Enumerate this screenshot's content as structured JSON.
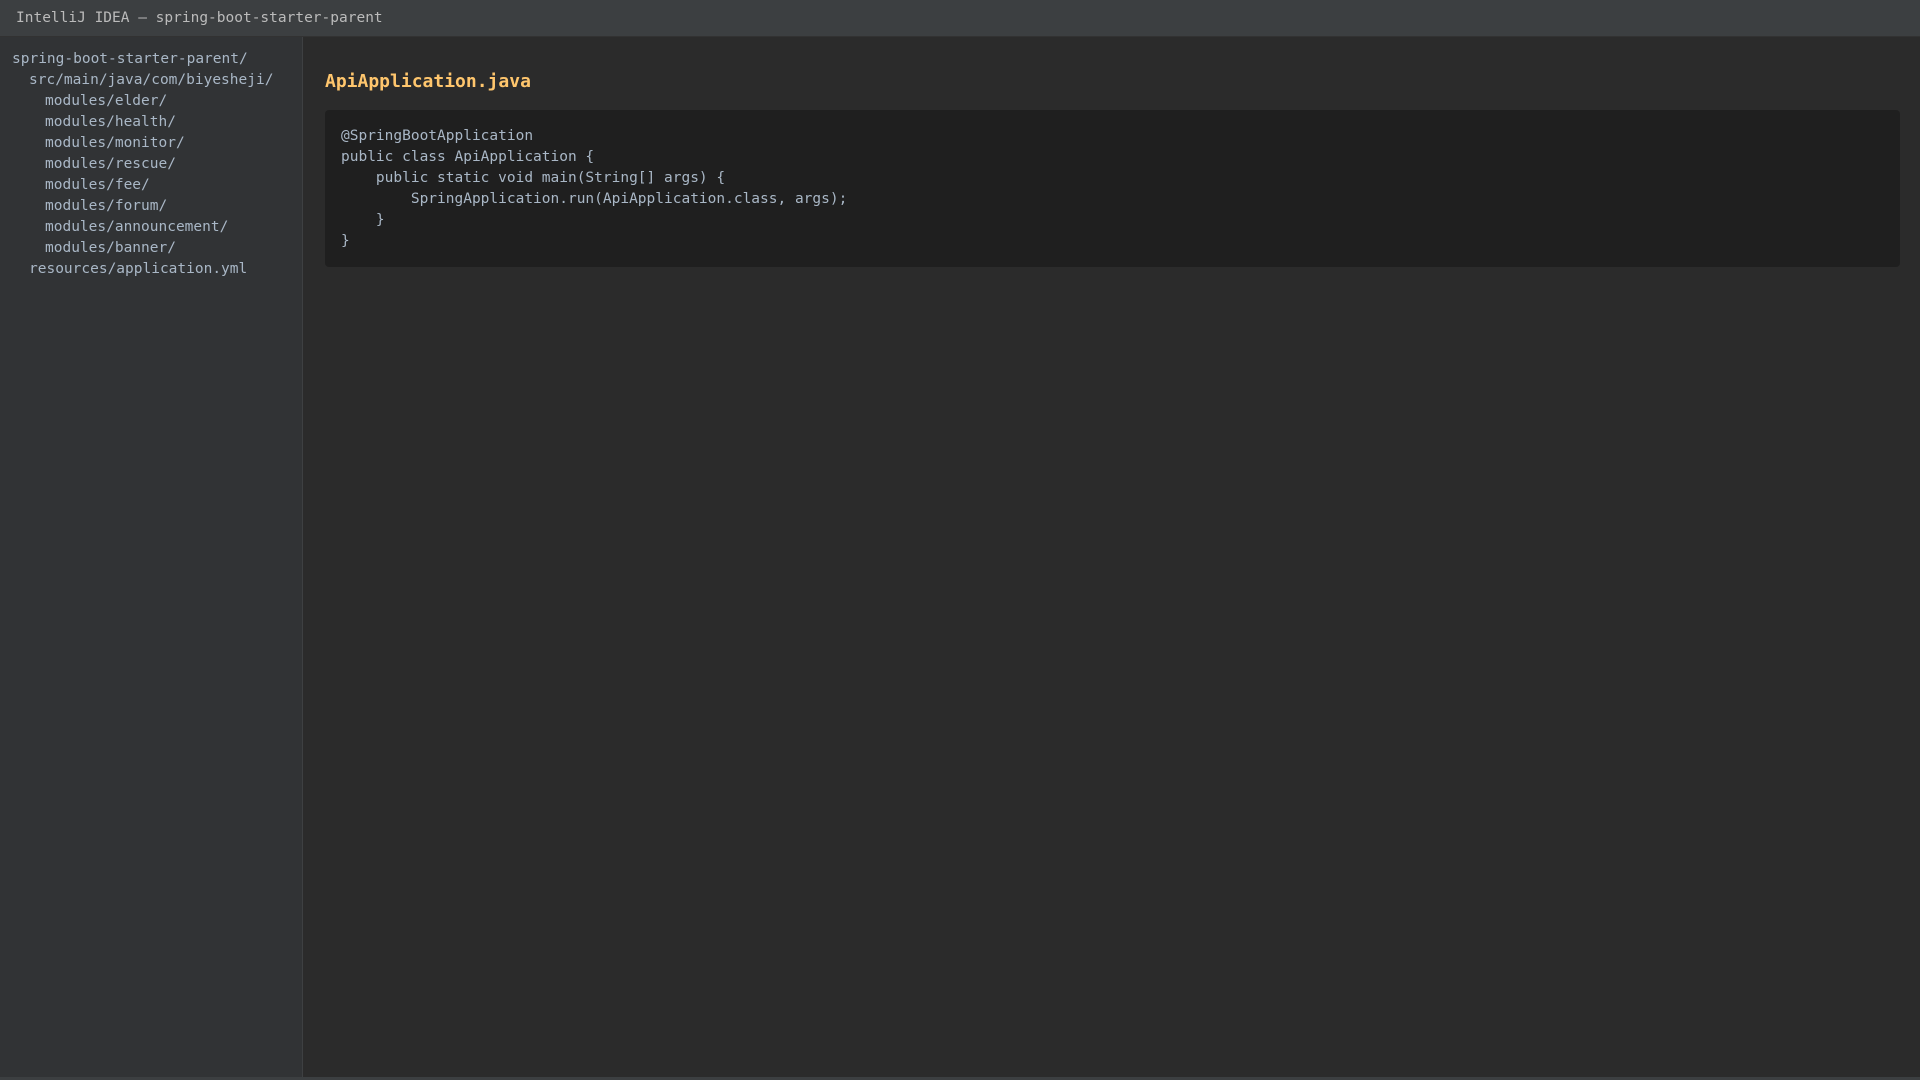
{
  "window": {
    "title": "IntelliJ IDEA — spring-boot-starter-parent"
  },
  "project_tree": {
    "items": [
      {
        "label": "spring-boot-starter-parent/",
        "depth": 0
      },
      {
        "label": "src/main/java/com/biyesheji/",
        "depth": 1
      },
      {
        "label": "modules/elder/",
        "depth": 2
      },
      {
        "label": "modules/health/",
        "depth": 2
      },
      {
        "label": "modules/monitor/",
        "depth": 2
      },
      {
        "label": "modules/rescue/",
        "depth": 2
      },
      {
        "label": "modules/fee/",
        "depth": 2
      },
      {
        "label": "modules/forum/",
        "depth": 2
      },
      {
        "label": "modules/announcement/",
        "depth": 2
      },
      {
        "label": "modules/banner/",
        "depth": 2
      },
      {
        "label": "resources/application.yml",
        "depth": 1
      }
    ]
  },
  "editor": {
    "file_name": "ApiApplication.java",
    "code_lines": [
      "@SpringBootApplication",
      "public class ApiApplication {",
      "    public static void main(String[] args) {",
      "        SpringApplication.run(ApiApplication.class, args);",
      "    }",
      "}"
    ]
  },
  "colors": {
    "title_bar": "#3c3f41",
    "sidebar": "#313335",
    "editor_background": "#2b2b2b",
    "code_background": "#1f1f1f",
    "text": "#a9b7c6",
    "file_title": "#ffc66d"
  }
}
